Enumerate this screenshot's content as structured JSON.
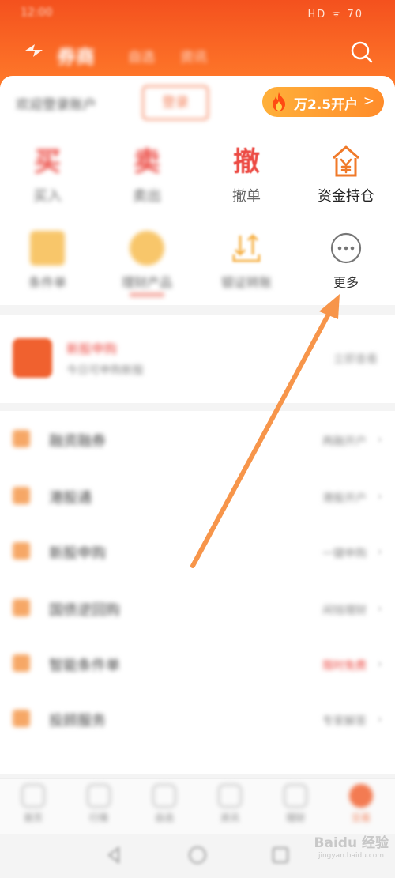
{
  "status_bar": {
    "time": "12:00",
    "icons": "HD ᯤ 70"
  },
  "header": {
    "brand": "券商",
    "links": [
      "自选",
      "资讯"
    ],
    "search_icon": "search-icon"
  },
  "account": {
    "label": "欢迎登录账户",
    "button": "登录",
    "promo": {
      "icon": "fire-icon",
      "text": "万2.5开户",
      "chevron": ">"
    }
  },
  "functions": [
    {
      "glyph": "买",
      "label": "买入",
      "color": "#ec4a43"
    },
    {
      "glyph": "卖",
      "label": "卖出",
      "color": "#ec4a43"
    },
    {
      "glyph": "撤",
      "label": "撤单",
      "color": "#ec4a43"
    },
    {
      "icon": "yen-house-icon",
      "label": "资金持仓",
      "color": "#f07a2a"
    }
  ],
  "functions_row2": [
    {
      "icon": "document-icon",
      "label": "条件单"
    },
    {
      "icon": "wallet-icon",
      "label": "理财产品"
    },
    {
      "icon": "transfer-icon",
      "label": "银证转账"
    },
    {
      "icon": "more-icon",
      "label": "更多"
    }
  ],
  "notice": {
    "title": "新股申购",
    "subtitle": "今日可申购新股",
    "right": "立即查看"
  },
  "menu": [
    {
      "title": "融资融券",
      "desc": "两融开户",
      "hot": false
    },
    {
      "title": "港股通",
      "desc": "港股开户",
      "hot": false
    },
    {
      "title": "新股申购",
      "desc": "一键申购",
      "hot": false
    },
    {
      "title": "国债逆回购",
      "desc": "闲钱理财",
      "hot": false
    },
    {
      "title": "智能条件单",
      "desc": "限时免费",
      "hot": true
    },
    {
      "title": "投顾服务",
      "desc": "专家解答",
      "hot": false
    }
  ],
  "tabbar": [
    {
      "label": "首页",
      "active": false
    },
    {
      "label": "行情",
      "active": false
    },
    {
      "label": "自选",
      "active": false
    },
    {
      "label": "资讯",
      "active": false
    },
    {
      "label": "理财",
      "active": false
    },
    {
      "label": "交易",
      "active": true
    }
  ],
  "watermark": {
    "main": "Baidu 经验",
    "sub": "jingyan.baidu.com"
  },
  "colors": {
    "brand": "#f4511e",
    "accent": "#ff8c2a",
    "arrow": "#f7954a",
    "danger": "#ec4a43"
  }
}
